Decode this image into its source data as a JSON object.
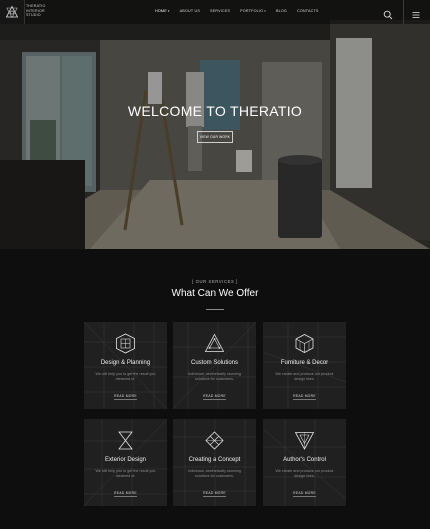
{
  "header": {
    "brand_lines": [
      "THERATIO",
      "INTERIOR",
      "STUDIO"
    ],
    "nav": [
      {
        "label": "HOME",
        "dropdown": true,
        "active": true
      },
      {
        "label": "ABOUT US",
        "dropdown": false
      },
      {
        "label": "SERVICES",
        "dropdown": false
      },
      {
        "label": "PORTFOLIO",
        "dropdown": true
      },
      {
        "label": "BLOG",
        "dropdown": false
      },
      {
        "label": "CONTACTS",
        "dropdown": false
      }
    ],
    "icons": {
      "search": "search-icon",
      "menu": "hamburger-menu-icon",
      "logo": "triangle-knot-logo"
    }
  },
  "hero": {
    "title": "WELCOME TO THERATIO",
    "button_label": "VIEW OUR WORK"
  },
  "services": {
    "eyebrow": "[ OUR SERVICES ]",
    "title": "What Can We Offer",
    "cards": [
      {
        "title": "Design & Planning",
        "desc": "We will help you to get the result you dreamed of.",
        "more": "READ MORE",
        "icon": "cube-grid-icon"
      },
      {
        "title": "Custom Solutions",
        "desc": "Individual, aesthetically stunning solutions for customers.",
        "more": "READ MORE",
        "icon": "triangle-pyramid-icon"
      },
      {
        "title": "Furniture & Decor",
        "desc": "We create and produce our product design lines.",
        "more": "READ MORE",
        "icon": "cube-lines-icon"
      },
      {
        "title": "Exterior Design",
        "desc": "We will help you to get the result you dreamed of.",
        "more": "READ MORE",
        "icon": "hourglass-icon"
      },
      {
        "title": "Creating a Concept",
        "desc": "Individual, aesthetically stunning solutions for customers.",
        "more": "READ MORE",
        "icon": "diamond-lattice-icon"
      },
      {
        "title": "Author's Control",
        "desc": "We create and produce our product design lines.",
        "more": "READ MORE",
        "icon": "inverted-triangle-icon"
      }
    ]
  },
  "colors": {
    "background": "#0e0e0e",
    "card": "#202020",
    "text": "#ffffff",
    "muted": "#8c8c8c"
  }
}
